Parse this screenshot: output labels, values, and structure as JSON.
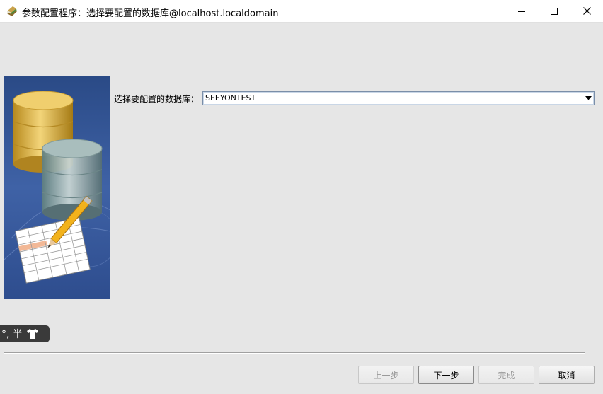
{
  "window": {
    "title": "参数配置程序：选择要配置的数据库@localhost.localdomain",
    "app_icon": "books-icon",
    "controls": [
      "minimize-icon",
      "maximize-icon",
      "close-icon"
    ]
  },
  "form": {
    "db_label": "选择要配置的数据库：",
    "db_selected": "SEEYONTEST"
  },
  "ime": {
    "text": "°, 半",
    "icon": "shirt-icon"
  },
  "buttons": {
    "prev": "上一步",
    "next": "下一步",
    "finish": "完成",
    "cancel": "取消"
  },
  "colors": {
    "background": "#e6e6e6",
    "banner": "#3b5a94",
    "disabled_text": "#9a9a9a"
  }
}
